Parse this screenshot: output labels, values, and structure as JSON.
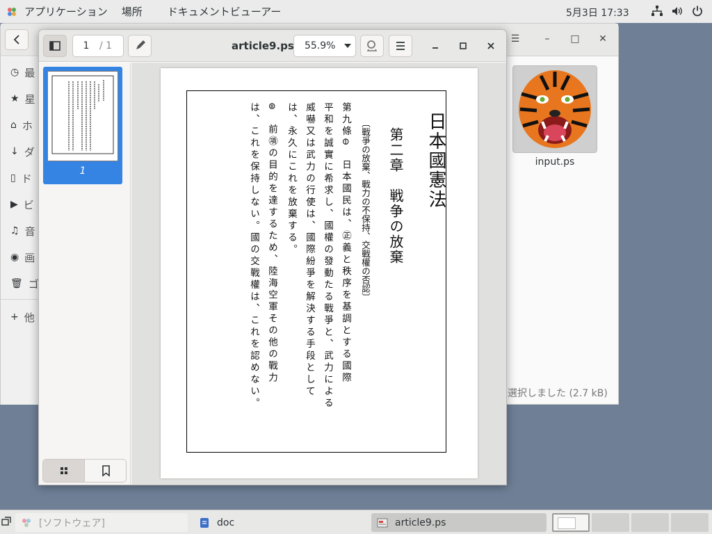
{
  "topbar": {
    "applications": "アプリケーション",
    "places": "場所",
    "active_app": "ドキュメントビューアー",
    "clock": "5月3日 17:33",
    "icons": [
      "network-icon",
      "volume-icon",
      "power-icon"
    ]
  },
  "file_manager": {
    "sidebar_items": [
      {
        "icon": "clock-icon",
        "label": "最"
      },
      {
        "icon": "star-icon",
        "label": "星"
      },
      {
        "icon": "home-icon",
        "label": "ホ"
      },
      {
        "icon": "download-icon",
        "label": "ダ"
      },
      {
        "icon": "document-icon",
        "label": "ド"
      },
      {
        "icon": "video-icon",
        "label": "ビ"
      },
      {
        "icon": "music-icon",
        "label": "音"
      },
      {
        "icon": "camera-icon",
        "label": "画"
      },
      {
        "icon": "trash-icon",
        "label": "ゴ"
      },
      {
        "icon": "plus-icon",
        "label": "他"
      }
    ],
    "file_name": "input.ps",
    "status": "選択しました (2.7 kB)"
  },
  "viewer": {
    "title": "article9.ps",
    "page_current": "1",
    "page_total": "/ 1",
    "zoom": "55.9%",
    "thumbnail_number": "1"
  },
  "document": {
    "title": "日本國憲法",
    "chapter": "第二章　戦争の放棄",
    "subtitle": "〔戰爭の放棄、戰力の不保持、交戰權の否認〕",
    "lines": [
      "第九條⊖　日本國民は、㊣義と秩序を基調とする國際",
      "平和を誠實に希求し、國權の發動たる戰爭と、武力による",
      "威嚇又は武力の行使は、國際紛爭を解決する手段として",
      "は、永久にこれを放棄する。",
      "⊜　前㊠の目的を達するため、陸海空軍その他の戰力",
      "は、これを保持しない。國の交戰權は、これを認めない。"
    ]
  },
  "taskbar": {
    "software": "[ソフトウェア]",
    "doc": "doc",
    "viewer": "article9.ps"
  }
}
